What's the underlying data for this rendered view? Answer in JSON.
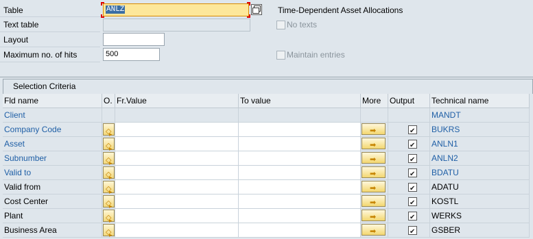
{
  "header": {
    "table_label": "Table",
    "table_value": "ANLZ",
    "table_description": "Time-Dependent Asset Allocations",
    "text_table_label": "Text table",
    "text_table_value": "",
    "no_texts_label": "No texts",
    "layout_label": "Layout",
    "layout_value": "",
    "max_hits_label": "Maximum no. of hits",
    "max_hits_value": "500",
    "maintain_entries_label": "Maintain entries"
  },
  "selection": {
    "title": "Selection Criteria",
    "columns": {
      "fld_name": "Fld name",
      "option": "O.",
      "from_value": "Fr.Value",
      "to_value": "To value",
      "more": "More",
      "output": "Output",
      "technical_name": "Technical name"
    },
    "rows": [
      {
        "name": "Client",
        "tech": "MANDT",
        "key": true,
        "editable": false,
        "output": false
      },
      {
        "name": "Company Code",
        "tech": "BUKRS",
        "key": true,
        "editable": true,
        "output": true
      },
      {
        "name": "Asset",
        "tech": "ANLN1",
        "key": true,
        "editable": true,
        "output": true
      },
      {
        "name": "Subnumber",
        "tech": "ANLN2",
        "key": true,
        "editable": true,
        "output": true
      },
      {
        "name": "Valid to",
        "tech": "BDATU",
        "key": true,
        "editable": true,
        "output": true
      },
      {
        "name": "Valid from",
        "tech": "ADATU",
        "key": false,
        "editable": true,
        "output": true
      },
      {
        "name": "Cost Center",
        "tech": "KOSTL",
        "key": false,
        "editable": true,
        "output": true
      },
      {
        "name": "Plant",
        "tech": "WERKS",
        "key": false,
        "editable": true,
        "output": true
      },
      {
        "name": "Business Area",
        "tech": "GSBER",
        "key": false,
        "editable": true,
        "output": true
      }
    ]
  },
  "icons": {
    "value_help": "value-help-icon",
    "option": "selection-option-icon",
    "more": "multiple-selection-arrow-icon",
    "checkbox": "checkbox-check-icon"
  },
  "colors": {
    "background": "#dfe6ec",
    "key_field_text": "#1f5fa6",
    "focused_input": "#fde79a",
    "focus_corner": "#dd0000"
  }
}
